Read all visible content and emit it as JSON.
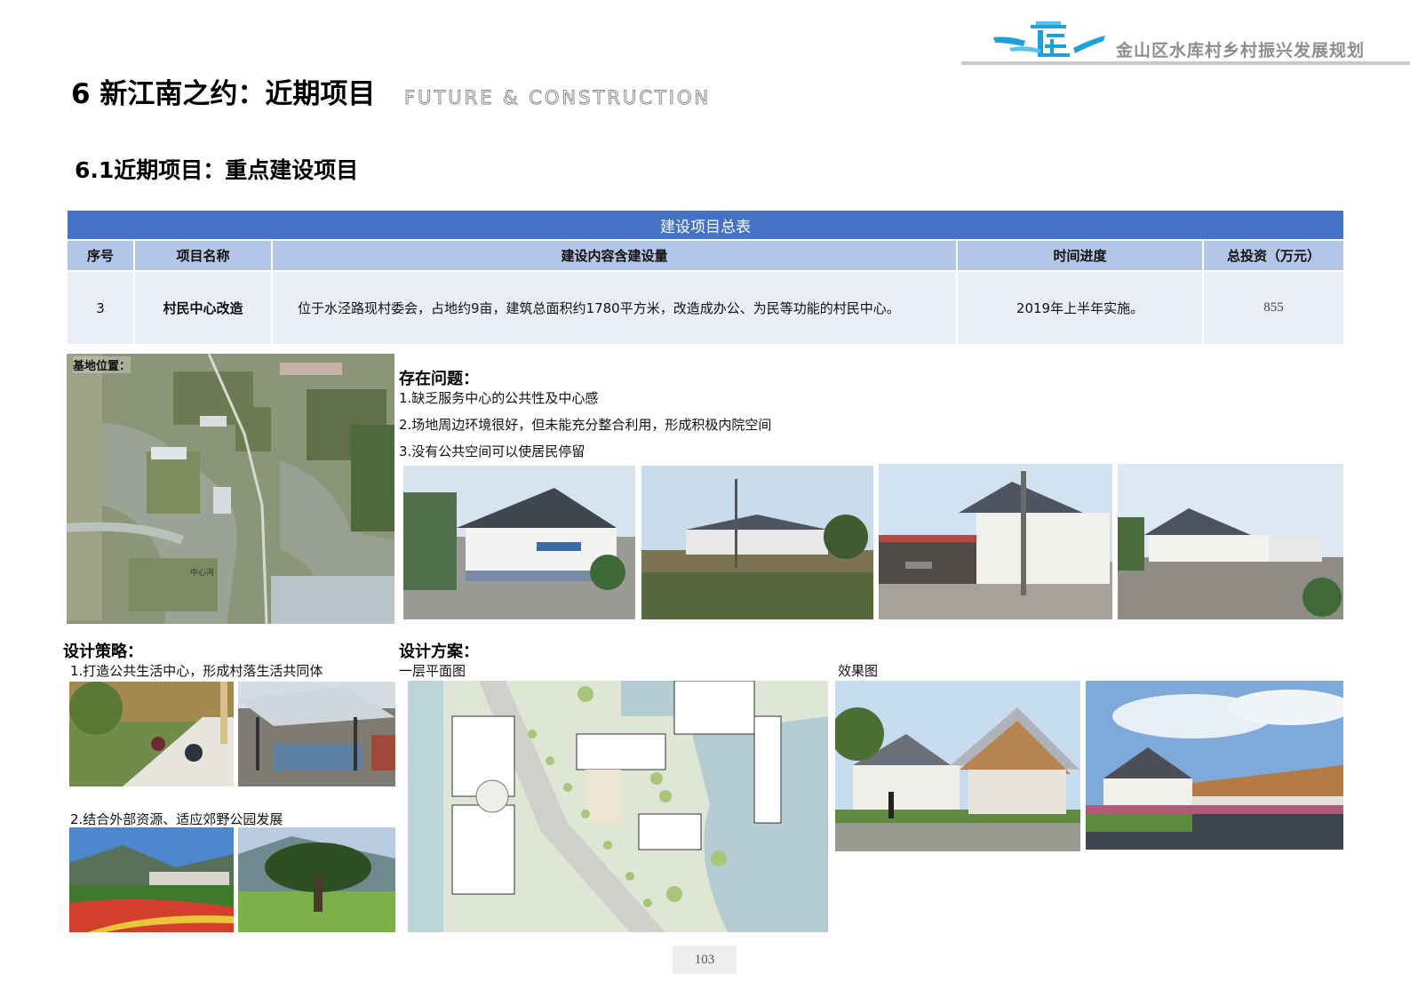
{
  "header": {
    "brand_title": "金山区水库村乡村振兴发展规划",
    "logo_icon": "village-logo-icon",
    "accent_color": "#1ea0d8"
  },
  "chapter": {
    "title": "6 新江南之约：近期项目",
    "subtitle_en": "FUTURE & CONSTRUCTION"
  },
  "section": {
    "title": "6.1近期项目：重点建设项目"
  },
  "table": {
    "caption": "建设项目总表",
    "header_color": "#4472c4",
    "columns": [
      "序号",
      "项目名称",
      "建设内容含建设量",
      "时间进度",
      "总投资（万元）"
    ],
    "rows": [
      [
        "3",
        "村民中心改造",
        "位于水泾路现村委会，占地约9亩，建筑总面积约1780平方米，改造成办公、为民等功能的村民中心。",
        "2019年上半年实施。",
        "855"
      ]
    ]
  },
  "site": {
    "label": "基地位置：",
    "river_label": "中心河"
  },
  "issues": {
    "heading": "存在问题：",
    "items": [
      "1.缺乏服务中心的公共性及中心感",
      "2.场地周边环境很好，但未能充分整合利用，形成积极内院空间",
      "3.没有公共空间可以使居民停留"
    ]
  },
  "strategy": {
    "heading": "设计策略：",
    "item1": "1.打造公共生活中心，形成村落生活共同体",
    "item2": "2.结合外部资源、适应郊野公园发展"
  },
  "design": {
    "heading": "设计方案：",
    "plan_label": "一层平面图",
    "render_label": "效果图"
  },
  "page": {
    "number": "103"
  }
}
